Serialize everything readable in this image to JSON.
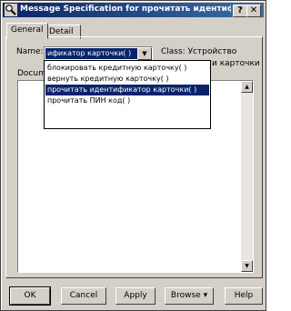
{
  "window": {
    "title": "Message Specification for прочитать идентифи...",
    "help_glyph": "?",
    "close_glyph": "✕",
    "app_icon": "magnifier-icon"
  },
  "tabs": [
    {
      "label": "General",
      "active": true
    },
    {
      "label": "Detail",
      "active": false
    }
  ],
  "general": {
    "name_label": "Name:",
    "name_value": "ификатор карточки( )",
    "class_label": "Class: Устройство",
    "class_label_2": "и карточки",
    "doc_label": "Docum"
  },
  "name_dropdown": {
    "options": [
      "блокировать кредитную карточку( )",
      "вернуть кредитную карточку( )",
      "прочитать идентификатор карточки( )",
      "прочитать ПИН код( )"
    ],
    "selected_index": 2
  },
  "buttons": {
    "ok": "OK",
    "cancel": "Cancel",
    "apply": "Apply",
    "browse": "Browse",
    "browse_arrow": "▾",
    "help": "Help"
  }
}
